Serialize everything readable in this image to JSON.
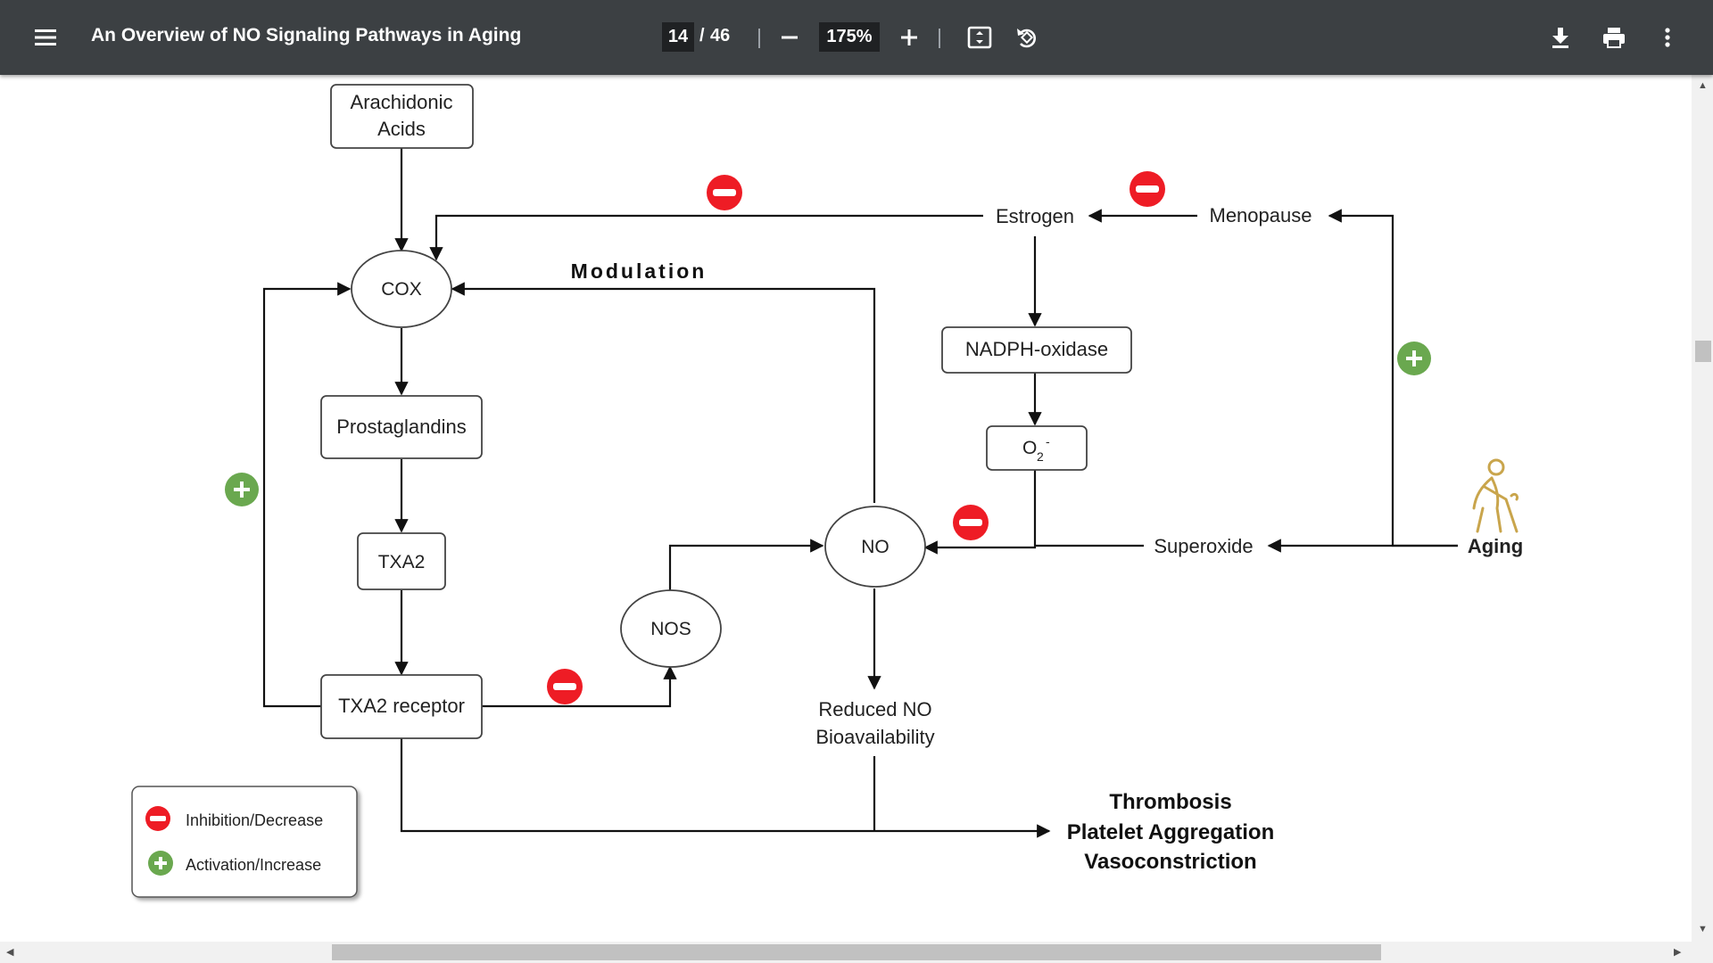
{
  "toolbar": {
    "title": "An Overview of NO Signaling Pathways in Aging",
    "current_page": "14",
    "page_separator": "/",
    "total_pages": "46",
    "zoom": "175%",
    "icons": [
      "menu-icon",
      "zoom-out-icon",
      "zoom-in-icon",
      "fit-page-icon",
      "rotate-icon",
      "download-icon",
      "print-icon",
      "more-vert-icon"
    ]
  },
  "diagram": {
    "nodes": {
      "arachidonic_line1": "Arachidonic",
      "arachidonic_line2": "Acids",
      "cox": "COX",
      "prostaglandins": "Prostaglandins",
      "txa2": "TXA2",
      "txa2_receptor": "TXA2 receptor",
      "nos": "NOS",
      "no": "NO",
      "reduced_line1": "Reduced NO",
      "reduced_line2": "Bioavailability",
      "estrogen": "Estrogen",
      "menopause": "Menopause",
      "nadph": "NADPH-oxidase",
      "o2_base": "O",
      "o2_sub": "2",
      "o2_sup": "-",
      "superoxide": "Superoxide",
      "aging": "Aging"
    },
    "modulation_label": "Modulation",
    "outcomes": [
      "Thrombosis",
      "Platelet Aggregation",
      "Vasoconstriction"
    ],
    "legend": {
      "inhibition": "Inhibition/Decrease",
      "activation": "Activation/Increase"
    },
    "colors": {
      "inhibition": "#ee1c25",
      "activation": "#6aa84f",
      "aging_figure": "#c9a54c"
    }
  },
  "scrollbars": {
    "icons": [
      "scroll-up-arrow-icon",
      "scroll-down-arrow-icon",
      "scroll-left-arrow-icon",
      "scroll-right-arrow-icon"
    ]
  }
}
